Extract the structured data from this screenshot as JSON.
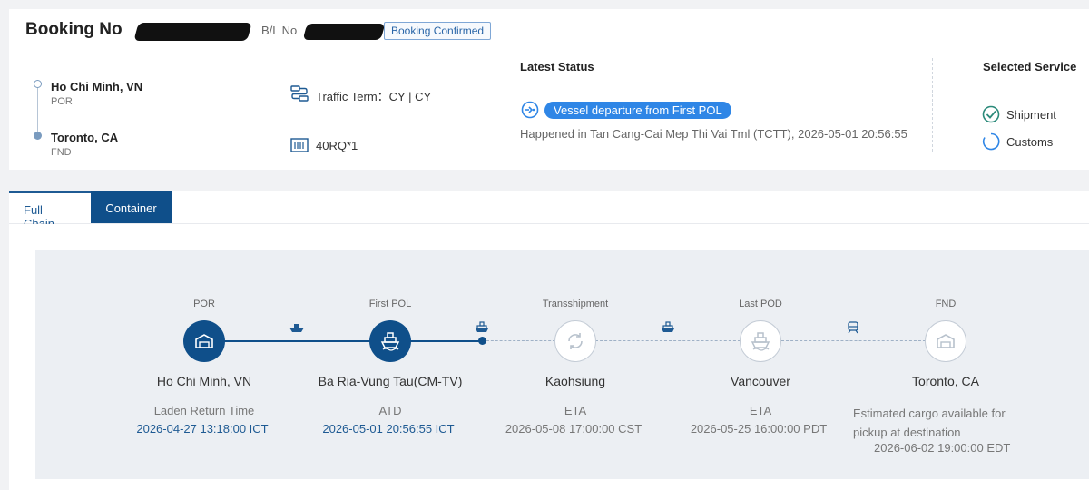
{
  "header": {
    "booking_label": "Booking No",
    "bl_label": "B/L No",
    "status_badge": "Booking Confirmed"
  },
  "route": {
    "origin": {
      "city": "Ho Chi Minh, VN",
      "code": "POR"
    },
    "destination": {
      "city": "Toronto, CA",
      "code": "FND"
    }
  },
  "terms": {
    "traffic_term": "Traffic Term：CY | CY",
    "container": "40RQ*1"
  },
  "latest_status": {
    "title": "Latest Status",
    "event": "Vessel departure from First POL",
    "happened": "Happened in Tan Cang-Cai Mep Thi Vai Tml (TCTT), 2026-05-01 20:56:55"
  },
  "services": {
    "title": "Selected Service",
    "items": [
      {
        "label": "Shipment",
        "selected": true
      },
      {
        "label": "Customs",
        "selected": false
      }
    ]
  },
  "tabs": [
    {
      "label": "Full Chain",
      "active": true
    },
    {
      "label": "Container",
      "active": false
    }
  ],
  "timeline": {
    "stages": [
      {
        "label": "POR",
        "place": "Ho Chi Minh, VN",
        "event": "Laden Return Time",
        "time": "2026-04-27 13:18:00 ICT",
        "done": true
      },
      {
        "label": "First POL",
        "place": "Ba Ria-Vung Tau(CM-TV)",
        "event": "ATD",
        "time": "2026-05-01 20:56:55 ICT",
        "done": true
      },
      {
        "label": "Transshipment",
        "place": "Kaohsiung",
        "event": "ETA",
        "time": "2026-05-08 17:00:00 CST",
        "done": false
      },
      {
        "label": "Last POD",
        "place": "Vancouver",
        "event": "ETA",
        "time": "2026-05-25 16:00:00 PDT",
        "done": false
      },
      {
        "label": "FND",
        "place": "Toronto, CA",
        "event": "Estimated cargo available for pickup at destination",
        "time": "2026-06-02 19:00:00 EDT",
        "done": false
      }
    ],
    "transport_icons": [
      "ship-icon",
      "vessel-icon",
      "vessel-icon",
      "rail-icon"
    ]
  },
  "colors": {
    "primary": "#0f4f8a",
    "accent": "#2f86e6",
    "badge_border": "#7fa7d6"
  }
}
